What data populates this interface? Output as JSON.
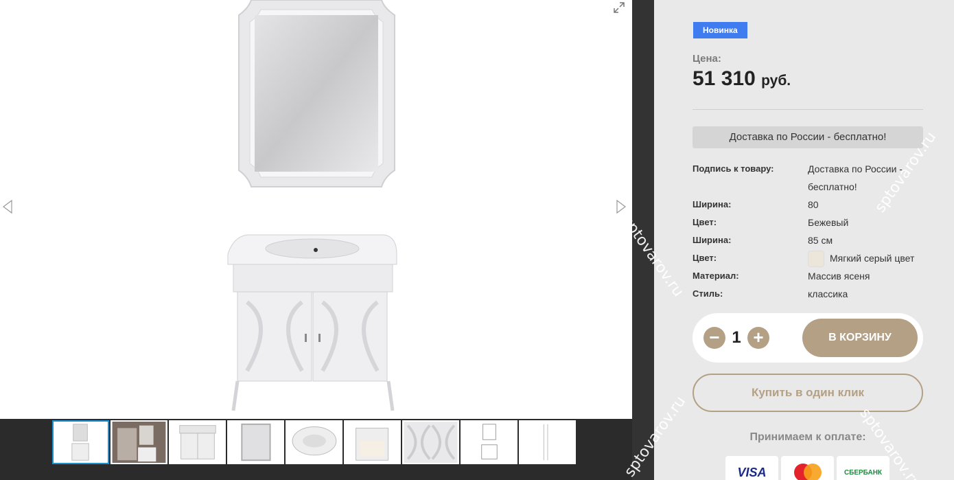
{
  "badge": "Новинка",
  "price": {
    "label": "Цена:",
    "amount": "51 310",
    "currency": "руб."
  },
  "delivery_banner": "Доставка по России - бесплатно!",
  "specs": [
    {
      "key": "Подпись к товару:",
      "value": "Доставка по России - бесплатно!"
    },
    {
      "key": "Ширина:",
      "value": "80"
    },
    {
      "key": "Цвет:",
      "value": "Бежевый"
    },
    {
      "key": "Ширина:",
      "value": "85 см"
    },
    {
      "key": "Цвет:",
      "value": "Мягкий серый цвет"
    },
    {
      "key": "Материал:",
      "value": "Массив ясеня"
    },
    {
      "key": "Стиль:",
      "value": "классика"
    }
  ],
  "cart": {
    "minus": "−",
    "quantity": "1",
    "plus": "+",
    "add_label": "В КОРЗИНУ"
  },
  "one_click_label": "Купить в один клик",
  "payment": {
    "label": "Принимаем к оплате:",
    "cards": [
      "VISA",
      "MasterCard",
      "СБЕРБАНК"
    ]
  },
  "watermark": "sptovarov.ru",
  "colors": {
    "accent": "#b3a085",
    "badge": "#3e7cf0",
    "thumb_active": "#1e8fd0"
  },
  "gallery": {
    "thumb_count": 9,
    "active_thumb": 0
  }
}
